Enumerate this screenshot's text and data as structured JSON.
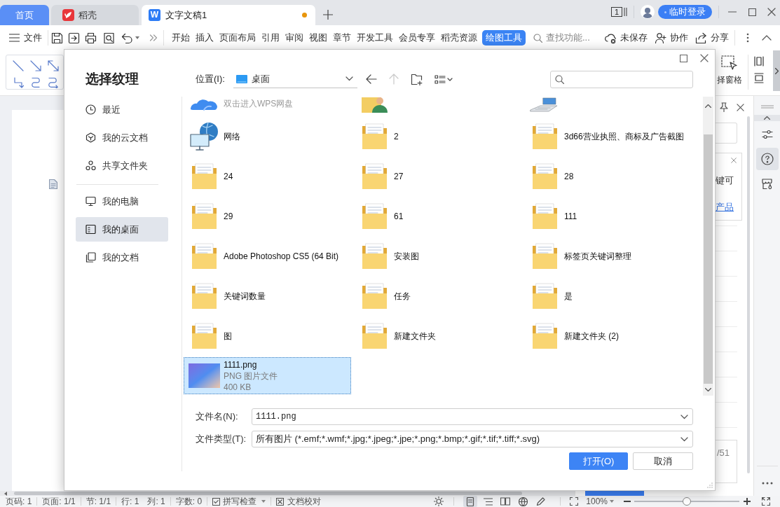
{
  "tabs": [
    {
      "label": "首页",
      "kind": "home",
      "selected": false,
      "unsaved": false
    },
    {
      "label": "稻壳",
      "kind": "docer",
      "selected": false,
      "unsaved": false
    },
    {
      "label": "文字文稿1",
      "kind": "writer",
      "icon_text": "W",
      "selected": true,
      "unsaved": true
    }
  ],
  "title_bar": {
    "window_count": "1",
    "login": "临时登录"
  },
  "toolbar": {
    "file_menu": "文件",
    "menu_tabs": [
      {
        "label": "开始",
        "selected": false
      },
      {
        "label": "插入",
        "selected": false
      },
      {
        "label": "页面布局",
        "selected": false
      },
      {
        "label": "引用",
        "selected": false
      },
      {
        "label": "审阅",
        "selected": false
      },
      {
        "label": "视图",
        "selected": false
      },
      {
        "label": "章节",
        "selected": false
      },
      {
        "label": "开发工具",
        "selected": false
      },
      {
        "label": "会员专享",
        "selected": false
      },
      {
        "label": "稻壳资源",
        "selected": false
      },
      {
        "label": "绘图工具",
        "selected": true
      }
    ],
    "search": {
      "placeholder": "查找功能..."
    },
    "actions": [
      {
        "kind": "unsaved",
        "label": "未保存"
      },
      {
        "kind": "collaborate",
        "label": "协作"
      },
      {
        "kind": "share",
        "label": "分享"
      }
    ]
  },
  "ribbon": {
    "select_pane": "择窗格"
  },
  "dialog": {
    "title": "选择纹理",
    "sidebar": {
      "groups": [
        [
          {
            "label": "最近",
            "kind": "recent",
            "selected": false
          },
          {
            "label": "我的云文档",
            "kind": "cloud",
            "selected": false
          },
          {
            "label": "共享文件夹",
            "kind": "shared",
            "selected": false
          }
        ],
        [
          {
            "label": "我的电脑",
            "kind": "computer",
            "selected": false
          },
          {
            "label": "我的桌面",
            "kind": "desktop",
            "selected": true
          },
          {
            "label": "我的文档",
            "kind": "documents",
            "selected": false
          }
        ]
      ]
    },
    "location": {
      "label": "位置(I):",
      "value": "桌面"
    },
    "nav": [
      {
        "kind": "back",
        "disabled": false
      },
      {
        "kind": "up",
        "disabled": true
      },
      {
        "kind": "new-folder",
        "disabled": false
      },
      {
        "kind": "view",
        "disabled": false
      }
    ],
    "files": [
      {
        "kind": "cloud",
        "details": [
          "双击进入WPS网盘"
        ],
        "selected": false
      },
      {
        "kind": "user",
        "selected": false
      },
      {
        "kind": "computer",
        "selected": false
      },
      {
        "kind": "network",
        "name": "网络",
        "selected": false
      },
      {
        "kind": "folder",
        "name": "2",
        "selected": false
      },
      {
        "kind": "folder",
        "name": "3d66营业执照、商标及广告截图",
        "selected": false
      },
      {
        "kind": "folder",
        "name": "24",
        "selected": false
      },
      {
        "kind": "folder",
        "name": "27",
        "selected": false
      },
      {
        "kind": "folder",
        "name": "28",
        "selected": false
      },
      {
        "kind": "folder",
        "name": "29",
        "selected": false
      },
      {
        "kind": "folder",
        "name": "61",
        "selected": false
      },
      {
        "kind": "folder",
        "name": "111",
        "selected": false
      },
      {
        "kind": "folder",
        "name": "Adobe Photoshop CS5 (64 Bit)",
        "selected": false
      },
      {
        "kind": "folder",
        "name": "安装图",
        "selected": false
      },
      {
        "kind": "folder",
        "name": "标签页关键词整理",
        "selected": false
      },
      {
        "kind": "folder",
        "name": "关键词数量",
        "selected": false
      },
      {
        "kind": "folder",
        "name": "任务",
        "selected": false
      },
      {
        "kind": "folder",
        "name": "是",
        "selected": false
      },
      {
        "kind": "folder",
        "name": "图",
        "selected": false
      },
      {
        "kind": "folder",
        "name": "新建文件夹",
        "selected": false
      },
      {
        "kind": "folder",
        "name": "新建文件夹 (2)",
        "selected": false
      },
      {
        "kind": "image",
        "name": "1111.png",
        "details": [
          "PNG 图片文件",
          "400 KB"
        ],
        "selected": true
      }
    ],
    "file_name": {
      "label": "文件名(N):",
      "value": "1111.png"
    },
    "file_type": {
      "label": "文件类型(T):",
      "value": "所有图片 (*.emf;*.wmf;*.jpg;*.jpeg;*.jpe;*.png;*.bmp;*.gif;*.tif;*.tiff;*.svg)"
    },
    "buttons": [
      {
        "label": "打开(O)",
        "kind": "primary"
      },
      {
        "label": "取消",
        "kind": "secondary"
      }
    ]
  },
  "task_pane": {
    "card_text": "键可",
    "card_link": "产品",
    "page_counter": "/51"
  },
  "right_sidebar": [
    {
      "kind": "settings",
      "selected": false
    },
    {
      "kind": "help",
      "selected": true
    },
    {
      "kind": "store",
      "selected": false
    }
  ],
  "status_bar": {
    "groups": [
      [
        "页码: 1"
      ],
      [
        "页面: 1/1"
      ],
      [
        "节: 1/1"
      ],
      [
        "行: 1",
        "列: 1"
      ],
      [
        "字数: 0"
      ]
    ],
    "spell_check": "拼写检查",
    "proofread": "文档校对",
    "views": [
      {
        "kind": "page",
        "selected": true
      },
      {
        "kind": "outline",
        "selected": false
      },
      {
        "kind": "reading",
        "selected": false
      },
      {
        "kind": "web",
        "selected": false
      },
      {
        "kind": "pen",
        "selected": false
      }
    ],
    "zoom": "100%",
    "zoom_slider": {
      "level": 0.5
    }
  }
}
